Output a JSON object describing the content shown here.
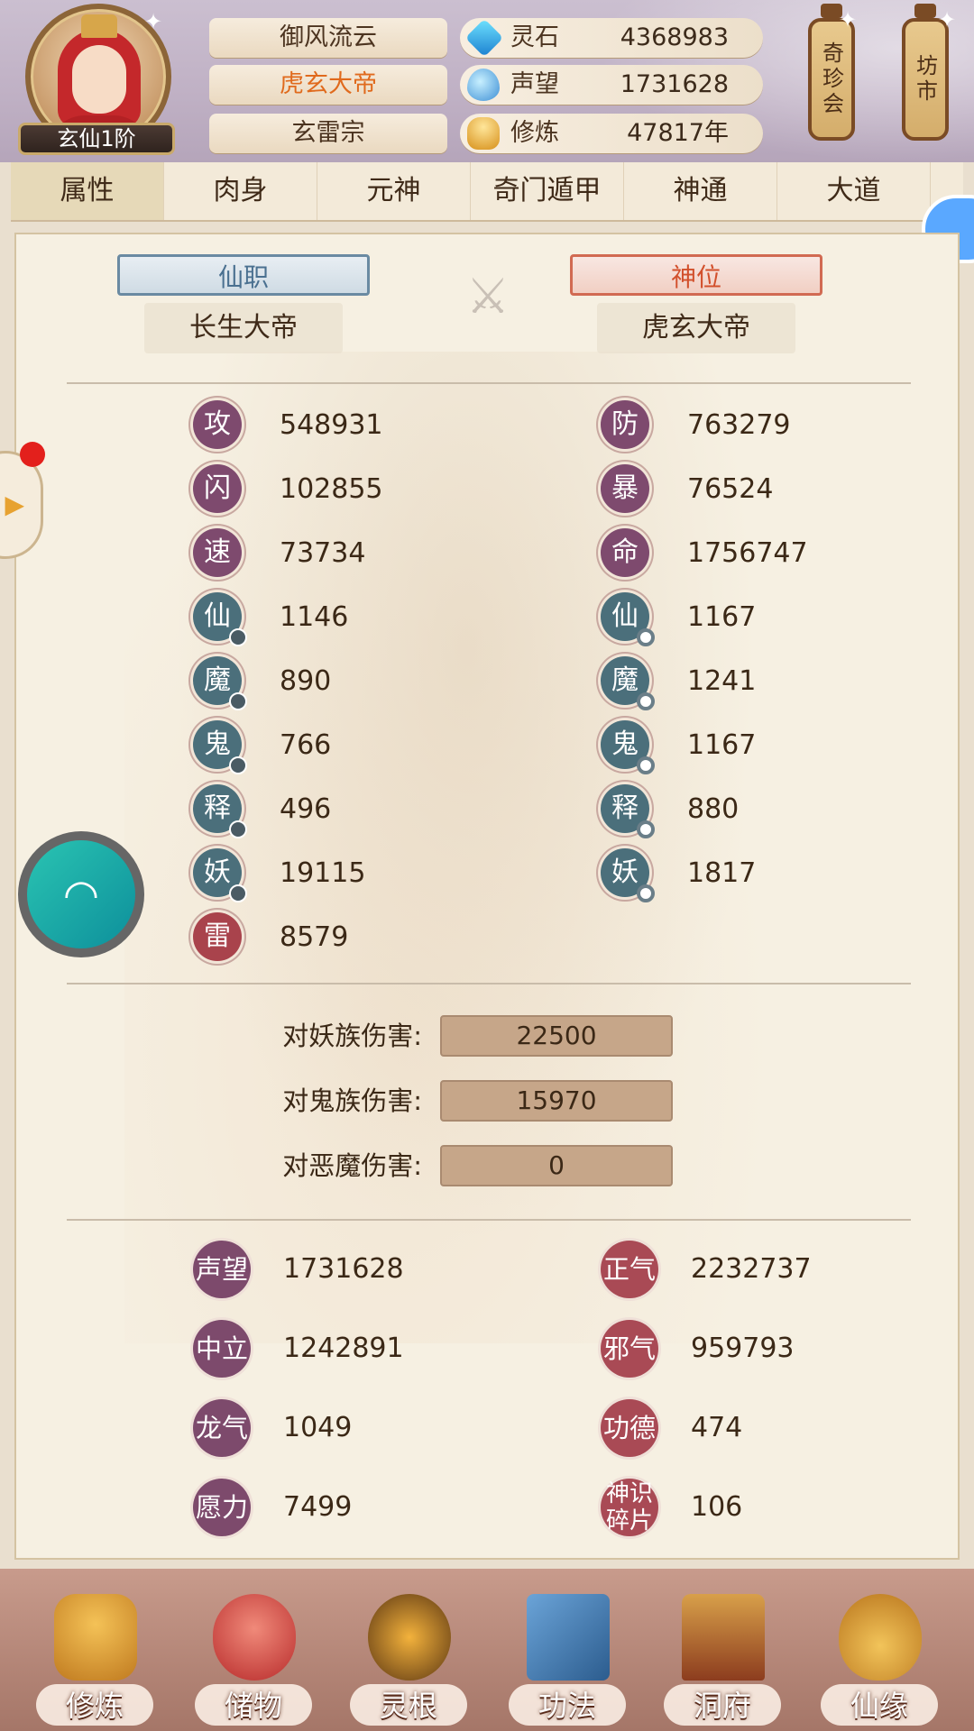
{
  "header": {
    "rank_badge": "玄仙1阶",
    "names": [
      "御风流云",
      "虎玄大帝",
      "玄雷宗"
    ],
    "resources": [
      {
        "label": "灵石",
        "value": "4368983",
        "icon": "spirit-stone-icon"
      },
      {
        "label": "声望",
        "value": "1731628",
        "icon": "fame-icon"
      },
      {
        "label": "修炼",
        "value": "47817年",
        "icon": "cultivation-icon"
      }
    ],
    "lanterns": [
      {
        "label": "奇珍会"
      },
      {
        "label": "坊市"
      }
    ]
  },
  "tabs": [
    "属性",
    "肉身",
    "元神",
    "奇门遁甲",
    "神通",
    "大道"
  ],
  "titles": {
    "official": {
      "label": "仙职",
      "value": "长生大帝"
    },
    "divine": {
      "label": "神位",
      "value": "虎玄大帝"
    }
  },
  "stats": {
    "left": [
      {
        "icon": "攻",
        "value": "548931"
      },
      {
        "icon": "闪",
        "value": "102855"
      },
      {
        "icon": "速",
        "value": "73734"
      },
      {
        "icon": "仙",
        "value": "1146"
      },
      {
        "icon": "魔",
        "value": "890"
      },
      {
        "icon": "鬼",
        "value": "766"
      },
      {
        "icon": "释",
        "value": "496"
      },
      {
        "icon": "妖",
        "value": "19115"
      },
      {
        "icon": "雷",
        "value": "8579"
      }
    ],
    "right": [
      {
        "icon": "防",
        "value": "763279"
      },
      {
        "icon": "暴",
        "value": "76524"
      },
      {
        "icon": "命",
        "value": "1756747"
      },
      {
        "icon": "仙",
        "value": "1167"
      },
      {
        "icon": "魔",
        "value": "1241"
      },
      {
        "icon": "鬼",
        "value": "1167"
      },
      {
        "icon": "释",
        "value": "880"
      },
      {
        "icon": "妖",
        "value": "1817"
      }
    ]
  },
  "damage": [
    {
      "label": "对妖族伤害:",
      "value": "22500"
    },
    {
      "label": "对鬼族伤害:",
      "value": "15970"
    },
    {
      "label": "对恶魔伤害:",
      "value": "0"
    }
  ],
  "reputation": {
    "left": [
      {
        "label": "声望",
        "value": "1731628"
      },
      {
        "label": "中立",
        "value": "1242891"
      },
      {
        "label": "龙气",
        "value": "1049"
      },
      {
        "label": "愿力",
        "value": "7499"
      }
    ],
    "right": [
      {
        "label": "正气",
        "value": "2232737"
      },
      {
        "label": "邪气",
        "value": "959793"
      },
      {
        "label": "功德",
        "value": "474"
      },
      {
        "label": "神识碎片",
        "value": "106"
      }
    ]
  },
  "bottom_nav": [
    {
      "label": "修炼",
      "icon": "monk-icon"
    },
    {
      "label": "储物",
      "icon": "bag-icon"
    },
    {
      "label": "灵根",
      "icon": "spirit-root-icon"
    },
    {
      "label": "功法",
      "icon": "book-icon"
    },
    {
      "label": "洞府",
      "icon": "palace-icon"
    },
    {
      "label": "仙缘",
      "icon": "gourd-icon"
    }
  ],
  "colors": {
    "accent_orange": "#e06a1d",
    "stat_purple": "#7e4a6e",
    "stat_teal": "#4b6f7b",
    "damage_bar": "#c6a689"
  }
}
